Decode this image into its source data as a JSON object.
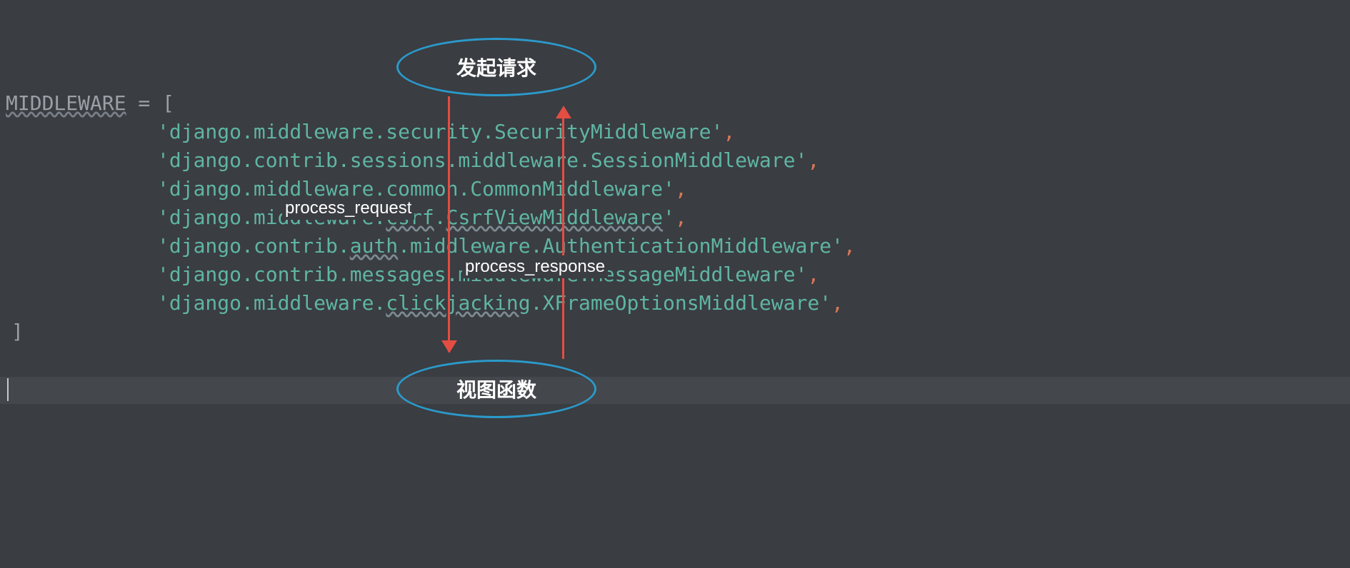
{
  "code": {
    "declaration": "MIDDLEWARE",
    "equals": " = [",
    "middleware_items": [
      {
        "text": "'django.middleware.security.SecurityMiddleware'",
        "wavy": false
      },
      {
        "text": "'django.contrib.sessions.middleware.SessionMiddleware'",
        "wavy": false
      },
      {
        "text": "'django.middleware.common.CommonMiddleware'",
        "wavy": false
      },
      {
        "text": "'django.middleware.csrf.CsrfViewMiddleware'",
        "wavy": true,
        "wavy_parts": [
          "csrf",
          "CsrfViewMiddleware"
        ]
      },
      {
        "text": "'django.contrib.auth.middleware.AuthenticationMiddleware'",
        "wavy": true,
        "wavy_parts": [
          "auth"
        ]
      },
      {
        "text": "'django.contrib.messages.middleware.MessageMiddleware'",
        "wavy": false
      },
      {
        "text": "'django.middleware.clickjacking.XFrameOptionsMiddleware'",
        "wavy": true,
        "wavy_parts": [
          "clickjacking"
        ]
      }
    ],
    "closing": "]"
  },
  "diagram": {
    "top_ellipse": "发起请求",
    "bottom_ellipse": "视图函数",
    "request_label": "process_request",
    "response_label": "process_response"
  }
}
